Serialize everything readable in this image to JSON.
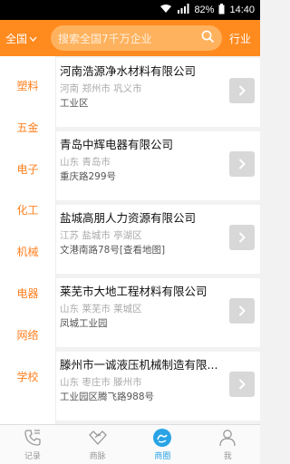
{
  "statusbar": {
    "battery": "82%",
    "time": "14:40"
  },
  "header": {
    "region": "全国",
    "search_placeholder": "搜索全国7千万企业",
    "industry_label": "行业"
  },
  "categories": [
    "塑料",
    "五金",
    "电子",
    "化工",
    "机械",
    "电器",
    "网络",
    "学校"
  ],
  "companies": [
    {
      "name": "河南浩源净水材料有限公司",
      "location": "河南 郑州市 巩义市",
      "address": "工业区"
    },
    {
      "name": "青岛中辉电器有限公司",
      "location": "山东 青岛市",
      "address": "重庆路299号"
    },
    {
      "name": "盐城高朋人力资源有限公司",
      "location": "江苏 盐城市 亭湖区",
      "address": "文港南路78号[查看地图]"
    },
    {
      "name": "莱芜市大地工程材料有限公司",
      "location": "山东 莱芜市 莱城区",
      "address": "凤城工业园"
    },
    {
      "name": "滕州市一诚液压机械制造有限...",
      "location": "山东 枣庄市 滕州市",
      "address": "工业园区腾飞路988号"
    }
  ],
  "tabs": [
    {
      "label": "记录",
      "icon": "phone-icon"
    },
    {
      "label": "商脉",
      "icon": "handshake-icon"
    },
    {
      "label": "商圈",
      "icon": "circle-icon"
    },
    {
      "label": "我",
      "icon": "person-icon"
    }
  ],
  "colors": {
    "accent": "#ff8a1e",
    "active_tab": "#29a3e6"
  }
}
